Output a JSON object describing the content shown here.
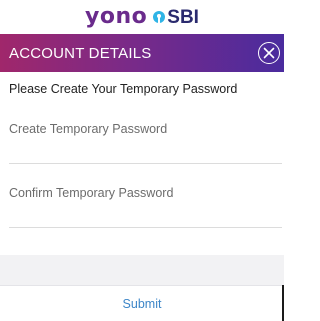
{
  "brand": {
    "yono": "yono",
    "sbi": "SBI",
    "colors": {
      "yono": "#6a2b8c",
      "sbi_logo": "#2fb4e6",
      "sbi_text": "#2a2a6e"
    }
  },
  "header": {
    "title": "ACCOUNT DETAILS",
    "close_icon": "close-circle-icon",
    "gradient": [
      "#a0276b",
      "#7a2a88",
      "#4a2b9e"
    ]
  },
  "form": {
    "instruction": "Please Create Your Temporary Password",
    "fields": [
      {
        "placeholder": "Create Temporary Password",
        "value": ""
      },
      {
        "placeholder": "Confirm Temporary Password",
        "value": ""
      }
    ]
  },
  "footer": {
    "submit_label": "Submit",
    "submit_color": "#3d86c8"
  }
}
